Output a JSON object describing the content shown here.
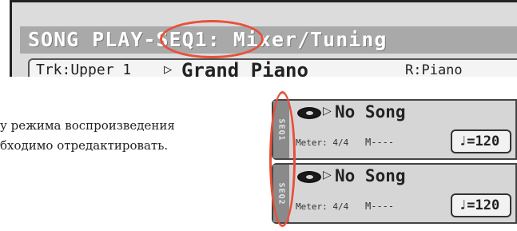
{
  "display": {
    "page_title": "SONG PLAY-SEQ1: Mixer/Tuning",
    "track": {
      "label": "Trk:Upper 1",
      "arrow": "▷",
      "sound": "Grand Piano",
      "bank": "R:Piano"
    }
  },
  "description": {
    "line1": "у режима воспроизведения",
    "line2": "бходимо отредактировать."
  },
  "seq_panels": [
    {
      "tab_label": "SEQ1",
      "arrow": "▷",
      "song": "No Song",
      "meter": "Meter: 4/4",
      "measure": "M----",
      "tempo": "♩=120"
    },
    {
      "tab_label": "SEQ2",
      "arrow": "▷",
      "song": "No Song",
      "meter": "Meter: 4/4",
      "measure": "M----",
      "tempo": "♩=120"
    }
  ],
  "colors": {
    "annotation": "#e8503a",
    "title_bar": "#a9a9a9"
  }
}
